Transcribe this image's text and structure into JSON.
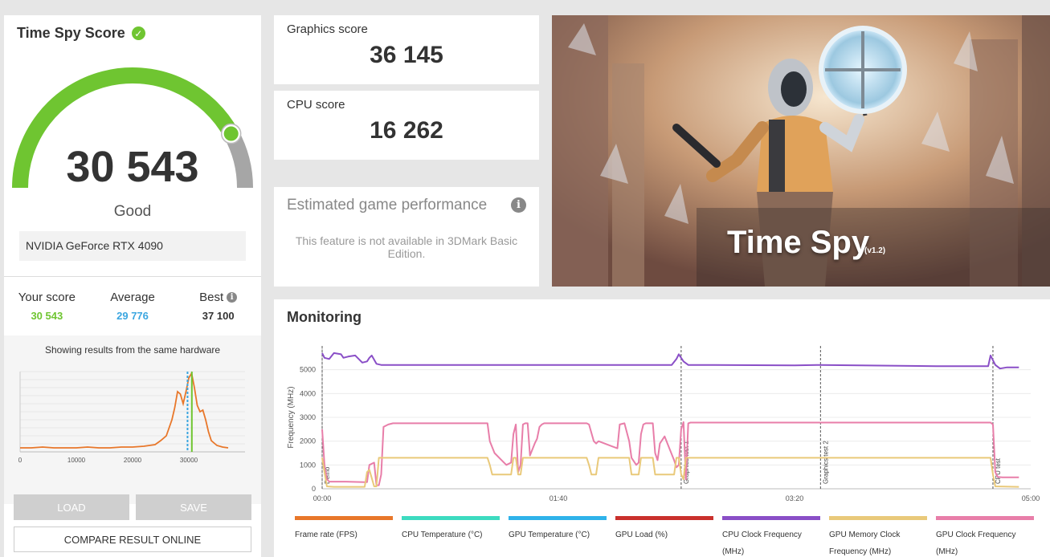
{
  "score_card": {
    "title": "Time Spy Score",
    "score": "30 543",
    "rating": "Good",
    "gpu": "NVIDIA GeForce RTX 4090",
    "stats": [
      {
        "label": "Your score",
        "value": "30 543",
        "color": "#6fc531"
      },
      {
        "label": "Average",
        "value": "29 776",
        "color": "#3ba6e0"
      },
      {
        "label": "Best",
        "value": "37 100",
        "color": "#333333"
      }
    ],
    "histogram_caption": "Showing results from the same hardware",
    "load_label": "LOAD",
    "save_label": "SAVE",
    "compare_label": "COMPARE RESULT ONLINE"
  },
  "gauge": {
    "fraction": 0.84,
    "fill_color": "#6fc531",
    "track_color": "#a6a6a6"
  },
  "graphics_score": {
    "label": "Graphics score",
    "value": "36 145"
  },
  "cpu_score": {
    "label": "CPU score",
    "value": "16 262"
  },
  "egp": {
    "title": "Estimated game performance",
    "message": "This feature is not available in 3DMark Basic Edition."
  },
  "hero": {
    "title": "Time Spy",
    "version": "(v1.2)"
  },
  "monitoring": {
    "title": "Monitoring",
    "legend": [
      {
        "label": "Frame rate (FPS)",
        "color": "#e8772a"
      },
      {
        "label": "CPU Temperature (°C)",
        "color": "#3ddbc0"
      },
      {
        "label": "GPU Temperature (°C)",
        "color": "#2fb3ea"
      },
      {
        "label": "GPU Load (%)",
        "color": "#c9302c"
      },
      {
        "label": "CPU Clock Frequency (MHz)",
        "color": "#8a4fc7"
      },
      {
        "label": "GPU Memory Clock Frequency (MHz)",
        "color": "#e9c97a"
      },
      {
        "label": "GPU Clock Frequency (MHz)",
        "color": "#e87ea9"
      }
    ]
  },
  "chart_data": [
    {
      "type": "area",
      "title": "Showing results from the same hardware",
      "x_ticks": [
        0,
        10000,
        20000,
        30000
      ],
      "xlim": [
        0,
        40000
      ],
      "your_score": 30543,
      "average": 29776,
      "series": [
        {
          "color": "#e8772a",
          "x": [
            0,
            2000,
            4000,
            6000,
            8000,
            10000,
            12000,
            14000,
            16000,
            18000,
            20000,
            22000,
            24000,
            25000,
            26000,
            27000,
            27500,
            28000,
            28500,
            29000,
            29500,
            30000,
            30500,
            31000,
            31500,
            32000,
            32500,
            33000,
            33500,
            34000,
            35000,
            36000,
            37000
          ],
          "y": [
            0.05,
            0.05,
            0.06,
            0.05,
            0.05,
            0.05,
            0.06,
            0.05,
            0.05,
            0.06,
            0.06,
            0.07,
            0.09,
            0.14,
            0.2,
            0.4,
            0.55,
            0.75,
            0.72,
            0.6,
            0.75,
            0.92,
            0.98,
            0.8,
            0.58,
            0.5,
            0.52,
            0.4,
            0.25,
            0.14,
            0.08,
            0.06,
            0.05
          ]
        }
      ]
    },
    {
      "type": "line",
      "title": "Monitoring",
      "ylabel": "Frequency (MHz)",
      "x_ticks": [
        "00:00",
        "01:40",
        "03:20",
        "05:00"
      ],
      "xlim": [
        0,
        300
      ],
      "y_ticks": [
        0,
        1000,
        2000,
        3000,
        4000,
        5000
      ],
      "ylim": [
        0,
        6000
      ],
      "markers": [
        {
          "t": 0,
          "label": "Demo"
        },
        {
          "t": 152,
          "label": "Graphics test 1"
        },
        {
          "t": 211,
          "label": "Graphics test 2"
        },
        {
          "t": 284,
          "label": "CPU test"
        }
      ],
      "series": [
        {
          "name": "CPU Clock Frequency (MHz)",
          "color": "#8a4fc7",
          "x": [
            0,
            1,
            3,
            5,
            8,
            9,
            11,
            14,
            17,
            19,
            20,
            21,
            23,
            25,
            30,
            60,
            100,
            148,
            150,
            151,
            153,
            155,
            160,
            200,
            211,
            260,
            282,
            283,
            285,
            287,
            290,
            295
          ],
          "y": [
            5700,
            5500,
            5450,
            5700,
            5650,
            5500,
            5550,
            5600,
            5300,
            5350,
            5500,
            5600,
            5250,
            5200,
            5200,
            5200,
            5200,
            5200,
            5450,
            5650,
            5350,
            5200,
            5200,
            5180,
            5200,
            5150,
            5150,
            5600,
            5200,
            5050,
            5100,
            5100
          ]
        },
        {
          "name": "GPU Clock Frequency (MHz)",
          "color": "#e87ea9",
          "x": [
            0,
            1,
            2,
            3,
            5,
            10,
            18,
            19,
            20,
            22,
            23,
            24,
            25,
            26,
            28,
            30,
            70,
            71,
            73,
            76,
            78,
            80,
            81,
            82,
            83,
            84,
            85,
            86,
            87,
            88,
            90,
            91,
            92,
            93,
            94,
            96,
            112,
            113,
            115,
            116,
            117,
            125,
            126,
            128,
            130,
            131,
            133,
            134,
            135,
            136,
            137,
            140,
            141,
            142,
            143,
            145,
            147,
            149,
            150,
            151,
            152,
            153,
            154,
            155,
            156,
            283,
            284,
            285,
            286,
            288,
            295
          ],
          "y": [
            2500,
            1000,
            400,
            300,
            300,
            300,
            280,
            280,
            1000,
            1100,
            150,
            150,
            600,
            2600,
            2700,
            2750,
            2750,
            2000,
            1500,
            1200,
            1000,
            1100,
            2300,
            2700,
            700,
            1000,
            2700,
            2750,
            2750,
            1400,
            1900,
            2100,
            2600,
            2700,
            2750,
            2750,
            2750,
            2700,
            2000,
            1900,
            2000,
            1700,
            2700,
            2750,
            2000,
            1300,
            1000,
            1100,
            2300,
            2700,
            2750,
            2750,
            1500,
            1200,
            1900,
            2200,
            1700,
            1200,
            900,
            1000,
            2500,
            2800,
            400,
            2750,
            2780,
            2780,
            2700,
            700,
            500,
            480,
            480
          ]
        },
        {
          "name": "GPU Memory Clock Frequency (MHz)",
          "color": "#e9c97a",
          "x": [
            0,
            1,
            2,
            5,
            18,
            19,
            20,
            22,
            23,
            24,
            25,
            26,
            70,
            71,
            72,
            78,
            80,
            81,
            82,
            83,
            84,
            85,
            86,
            94,
            96,
            112,
            113,
            114,
            116,
            117,
            120,
            127,
            130,
            131,
            134,
            135,
            136,
            137,
            140,
            141,
            144,
            146,
            149,
            150,
            151,
            152,
            153,
            154,
            155,
            283,
            284,
            285,
            295
          ],
          "y": [
            1300,
            700,
            100,
            80,
            80,
            700,
            800,
            100,
            100,
            1300,
            1300,
            1300,
            1300,
            1000,
            600,
            600,
            600,
            1300,
            1300,
            600,
            600,
            1300,
            1300,
            1300,
            1300,
            1300,
            1000,
            600,
            600,
            1300,
            1300,
            1300,
            1300,
            600,
            600,
            1300,
            1300,
            1300,
            1300,
            600,
            600,
            600,
            600,
            1300,
            1300,
            600,
            400,
            1300,
            1300,
            1300,
            600,
            100,
            80
          ]
        }
      ]
    }
  ]
}
